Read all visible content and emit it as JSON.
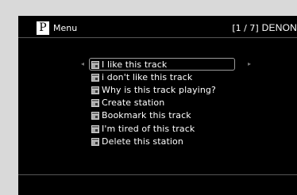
{
  "header": {
    "logo_letter": "P",
    "title": "Menu",
    "page_indicator": "[1 / 7]",
    "brand": "DENON"
  },
  "navigation": {
    "left_arrow": "◂",
    "right_arrow": "▸"
  },
  "menu": {
    "selected_index": 0,
    "items": [
      {
        "label": "I like this track",
        "icon": "track-icon"
      },
      {
        "label": "i don't like this track",
        "icon": "track-icon"
      },
      {
        "label": "Why is this track playing?",
        "icon": "track-icon"
      },
      {
        "label": "Create station",
        "icon": "track-icon"
      },
      {
        "label": "Bookmark this track",
        "icon": "track-icon"
      },
      {
        "label": "I'm tired of this track",
        "icon": "track-icon"
      },
      {
        "label": "Delete this station",
        "icon": "track-icon"
      }
    ]
  },
  "colors": {
    "screen_bg": "#000000",
    "frame_bg": "#d9d9d9",
    "text": "#ffffff",
    "selection_border": "#9a9a9a"
  }
}
